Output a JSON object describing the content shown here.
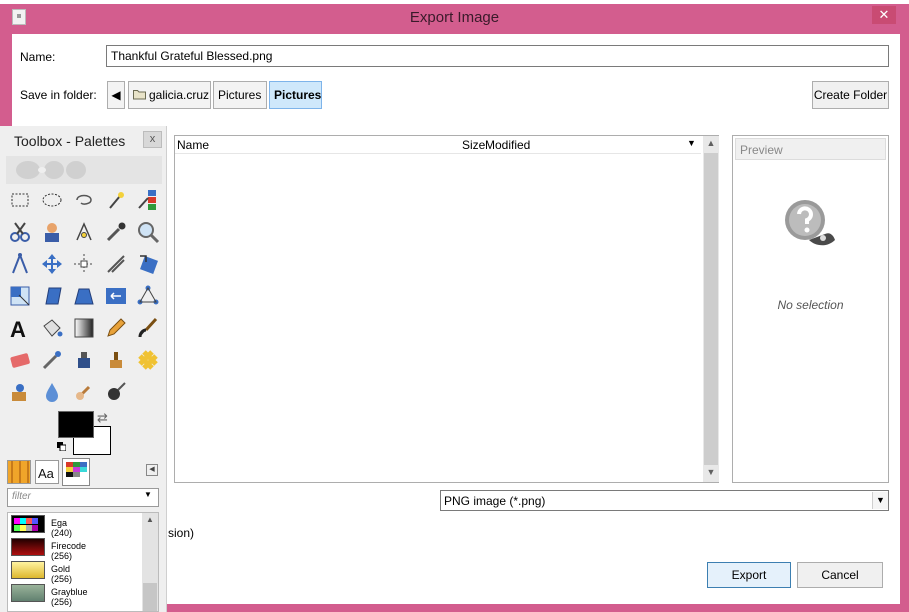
{
  "window": {
    "title": "Export Image",
    "close_glyph": "✕"
  },
  "form": {
    "name_label": "Name:",
    "name_value": "Thankful Grateful Blessed.png",
    "folder_label": "Save in folder:",
    "breadcrumbs": [
      "galicia.cruz",
      "Pictures",
      "Pictures"
    ],
    "create_folder_label": "Create Folder"
  },
  "file_list": {
    "col_name": "Name",
    "col_size": "Size",
    "col_modified": "Modified"
  },
  "preview": {
    "header": "Preview",
    "empty_text": "No selection"
  },
  "file_type": {
    "selected": "PNG image (*.png)"
  },
  "partial_label": "sion)",
  "buttons": {
    "export": "Export",
    "cancel": "Cancel"
  },
  "toolbox": {
    "title": "Toolbox - Palettes",
    "close_glyph": "x",
    "filter_placeholder": "filter",
    "palettes": [
      {
        "name": "Ega (240)"
      },
      {
        "name": "Firecode (256)"
      },
      {
        "name": "Gold (256)"
      },
      {
        "name": "Grayblue (256)"
      }
    ]
  },
  "colors": {
    "titlebar": "#d35d8e",
    "selected_crumb": "#cfe8fb",
    "fg_color": "#000000",
    "bg_color": "#ffffff"
  }
}
